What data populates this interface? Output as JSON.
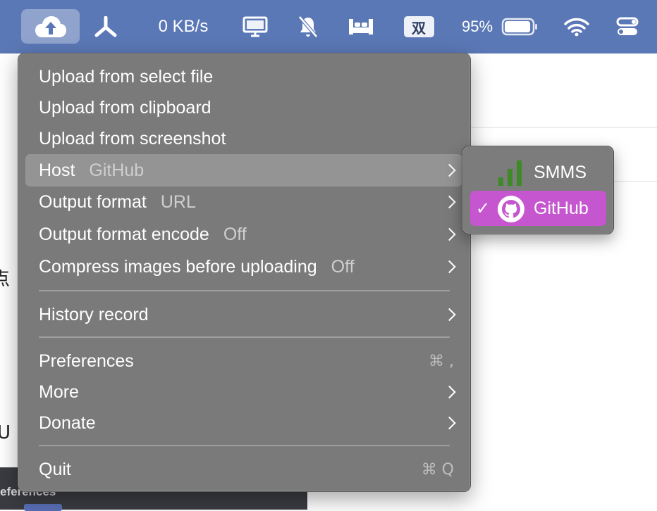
{
  "menubar": {
    "icons": [
      "cloud-upload-icon",
      "network-icon",
      "display-icon",
      "mute-icon",
      "bed-icon",
      "battery-icon",
      "wifi-icon",
      "control-center-icon"
    ],
    "network_speed": "0 KB/s",
    "input_method": "双",
    "battery_percent": "95%",
    "battery_level": 0.95,
    "background_color": "#5b78b6"
  },
  "background": {
    "glyph_1": "点",
    "glyph_2": "U",
    "window_title": "eferences"
  },
  "menu": {
    "upload_file": "Upload from select file",
    "upload_clipboard": "Upload from clipboard",
    "upload_screenshot": "Upload from screenshot",
    "host_label": "Host",
    "host_value": "GitHub",
    "output_format_label": "Output format",
    "output_format_value": "URL",
    "output_encode_label": "Output format encode",
    "output_encode_value": "Off",
    "compress_label": "Compress images before uploading",
    "compress_value": "Off",
    "history": "History record",
    "preferences": "Preferences",
    "preferences_shortcut": "⌘ ,",
    "more": "More",
    "donate": "Donate",
    "quit": "Quit",
    "quit_shortcut": "⌘ Q"
  },
  "host_submenu": {
    "items": [
      {
        "label": "SMMS",
        "icon": "smms-bars-icon",
        "checked": false
      },
      {
        "label": "GitHub",
        "icon": "github-icon",
        "checked": true
      }
    ],
    "check_mark": "✓",
    "selected_color": "#c556cf",
    "smms_icon_color": "#3d8a26"
  }
}
